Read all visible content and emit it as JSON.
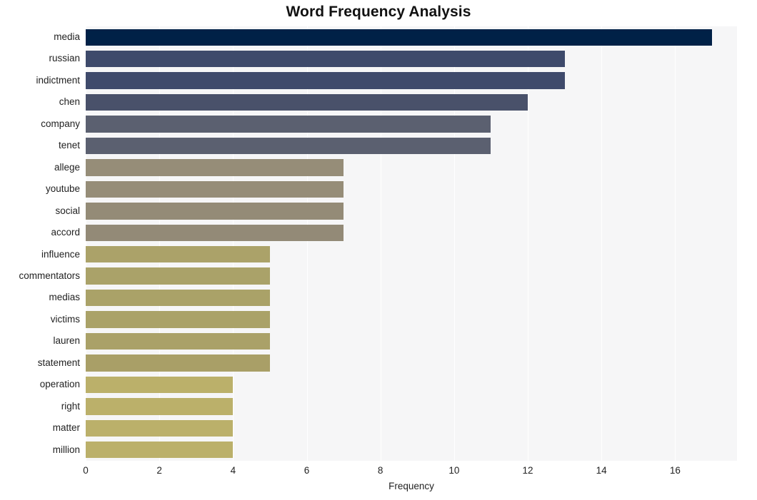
{
  "chart_data": {
    "type": "bar",
    "orientation": "horizontal",
    "title": "Word Frequency Analysis",
    "xlabel": "Frequency",
    "ylabel": "",
    "categories": [
      "media",
      "russian",
      "indictment",
      "chen",
      "company",
      "tenet",
      "allege",
      "youtube",
      "social",
      "accord",
      "influence",
      "commentators",
      "medias",
      "victims",
      "lauren",
      "statement",
      "operation",
      "right",
      "matter",
      "million"
    ],
    "values": [
      17,
      13,
      13,
      12,
      11,
      11,
      7,
      7,
      7,
      7,
      5,
      5,
      5,
      5,
      5,
      5,
      4,
      4,
      4,
      4
    ],
    "bar_colors": [
      "#002147",
      "#3e4a6b",
      "#3f4a6b",
      "#49516a",
      "#5b6070",
      "#5b6070",
      "#968d78",
      "#968d78",
      "#948b77",
      "#938a77",
      "#aba269",
      "#aaa269",
      "#aaa268",
      "#aaa268",
      "#aaa168",
      "#a99f67",
      "#bbb06a",
      "#bbb06a",
      "#bbb06a",
      "#bbb06a"
    ],
    "xticks": [
      0,
      2,
      4,
      6,
      8,
      10,
      12,
      14,
      16
    ],
    "xlim": [
      0,
      17.68
    ],
    "grid": true,
    "grid_axis": "x",
    "legend": "none",
    "plot_background": "#f6f6f7"
  },
  "colors": {
    "background": "#ffffff",
    "plot_background": "#f6f6f7",
    "gridline": "#ffffff",
    "text": "#222222",
    "title": "#111111"
  }
}
